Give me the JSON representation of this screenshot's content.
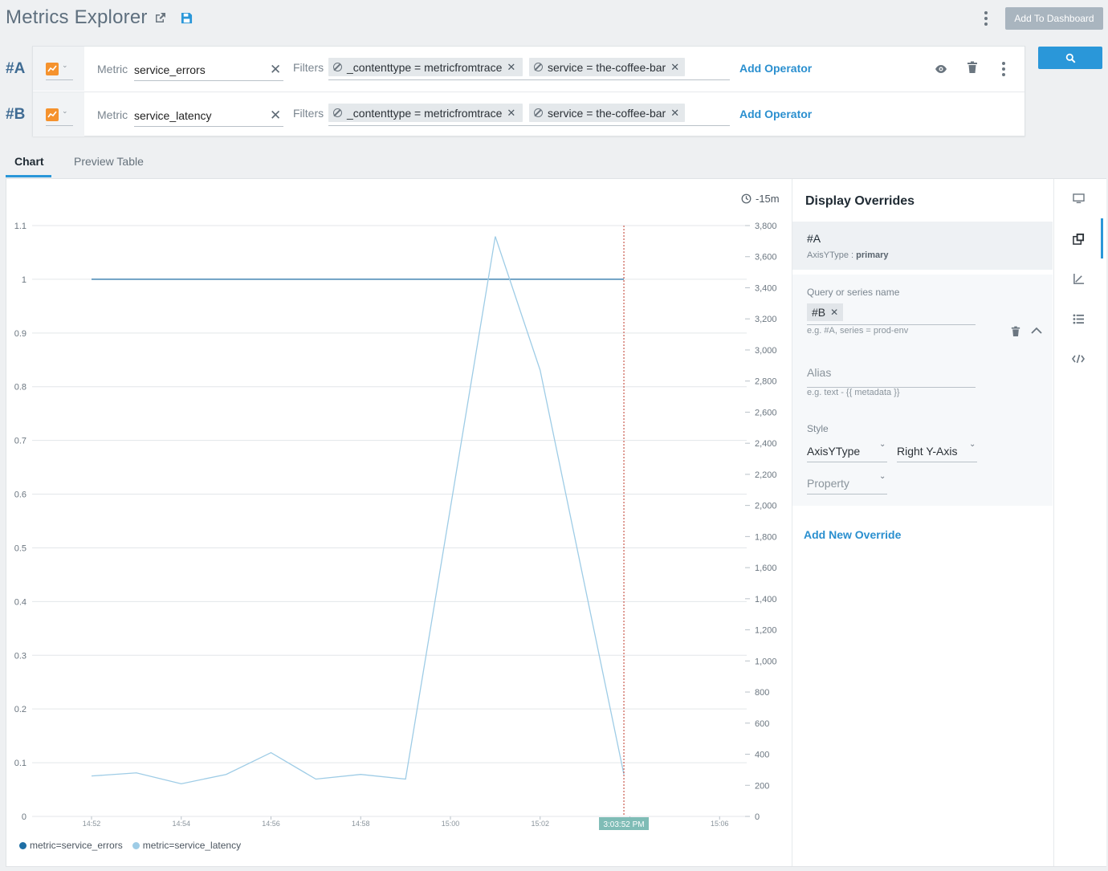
{
  "header": {
    "title": "Metrics Explorer",
    "add_to_dashboard": "Add To Dashboard"
  },
  "queries": [
    {
      "label": "#A",
      "metric_label": "Metric",
      "metric_value": "service_errors",
      "filters_label": "Filters",
      "filters": [
        "_contenttype = metricfromtrace",
        "service = the-coffee-bar"
      ],
      "add_operator": "Add Operator"
    },
    {
      "label": "#B",
      "metric_label": "Metric",
      "metric_value": "service_latency",
      "filters_label": "Filters",
      "filters": [
        "_contenttype = metricfromtrace",
        "service = the-coffee-bar"
      ],
      "add_operator": "Add Operator"
    }
  ],
  "tabs": [
    {
      "label": "Chart",
      "active": true
    },
    {
      "label": "Preview Table",
      "active": false
    }
  ],
  "time_range": "-15m",
  "chart_data": {
    "type": "line",
    "x": [
      "14:52",
      "14:53",
      "14:54",
      "14:55",
      "14:56",
      "14:57",
      "14:58",
      "14:59",
      "15:00",
      "15:01",
      "15:02",
      "15:03"
    ],
    "x_ticks": [
      "14:52",
      "14:54",
      "14:56",
      "14:58",
      "15:00",
      "15:02",
      "15:04",
      "15:06"
    ],
    "series": [
      {
        "name": "metric=service_errors",
        "axis": "left",
        "color": "#1f6fa5",
        "values": [
          1,
          1,
          1,
          1,
          1,
          1,
          1,
          1,
          1,
          1,
          1,
          1
        ]
      },
      {
        "name": "metric=service_latency",
        "axis": "right",
        "color": "#9ecce6",
        "values": [
          260,
          280,
          210,
          270,
          410,
          240,
          270,
          240,
          null,
          3730,
          2870,
          270
        ]
      }
    ],
    "latency_points": [
      {
        "t": "14:52",
        "v": 260
      },
      {
        "t": "14:53",
        "v": 280
      },
      {
        "t": "14:54",
        "v": 210
      },
      {
        "t": "14:55",
        "v": 270
      },
      {
        "t": "14:56",
        "v": 410
      },
      {
        "t": "14:57",
        "v": 240
      },
      {
        "t": "14:58",
        "v": 270
      },
      {
        "t": "14:59",
        "v": 240
      },
      {
        "t": "15:01",
        "v": 3730
      },
      {
        "t": "15:02",
        "v": 2870
      },
      {
        "t": "15:03:52",
        "v": 270
      }
    ],
    "y_left_ticks": [
      "0",
      "0.1",
      "0.2",
      "0.3",
      "0.4",
      "0.5",
      "0.6",
      "0.7",
      "0.8",
      "0.9",
      "1",
      "1.1"
    ],
    "y_left_range": [
      0,
      1.1
    ],
    "y_right_ticks": [
      "0",
      "200",
      "400",
      "600",
      "800",
      "1,000",
      "1,200",
      "1,400",
      "1,600",
      "1,800",
      "2,000",
      "2,200",
      "2,400",
      "2,600",
      "2,800",
      "3,000",
      "3,200",
      "3,400",
      "3,600",
      "3,800"
    ],
    "y_right_range": [
      0,
      3800
    ],
    "cursor_label": "3:03:52 PM",
    "grid": true,
    "legend_position": "bottom-left"
  },
  "overrides": {
    "title": "Display Overrides",
    "item_a": {
      "name": "#A",
      "sub_key": "AxisYType :",
      "sub_val": "primary"
    },
    "query_label": "Query or series name",
    "query_chip": "#B",
    "query_hint": "e.g. #A, series = prod-env",
    "alias_placeholder": "Alias",
    "alias_hint": "e.g. text - {{ metadata }}",
    "style_label": "Style",
    "style_select": "AxisYType",
    "axis_select": "Right Y-Axis",
    "property_placeholder": "Property",
    "add_new": "Add New Override"
  },
  "colors": {
    "accent": "#2a97d9",
    "orange": "#f5922d",
    "errors": "#1f6fa5",
    "latency": "#9ecce6",
    "cursor": "#c0392b"
  }
}
